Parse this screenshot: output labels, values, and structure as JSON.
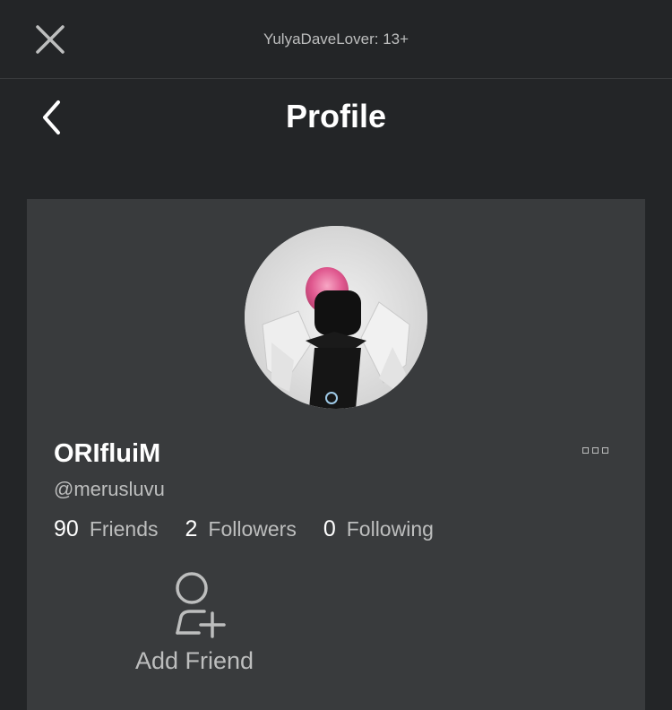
{
  "topbar": {
    "close_icon": "close-icon",
    "account_label": "YulyaDaveLover: 13+"
  },
  "header": {
    "back_icon": "chevron-left-icon",
    "title": "Profile"
  },
  "profile": {
    "avatar": "avatar-icon",
    "display_name": "ORIfluiM",
    "username": "@merusluvu",
    "more_icon": "more-options-icon",
    "stats": [
      {
        "count": "90",
        "label": "Friends"
      },
      {
        "count": "2",
        "label": "Followers"
      },
      {
        "count": "0",
        "label": "Following"
      }
    ],
    "add_friend": {
      "icon": "add-friend-icon",
      "label": "Add Friend"
    }
  },
  "colors": {
    "background": "#232527",
    "card": "#393b3d",
    "text_primary": "#ffffff",
    "text_secondary": "#bdbebe"
  }
}
